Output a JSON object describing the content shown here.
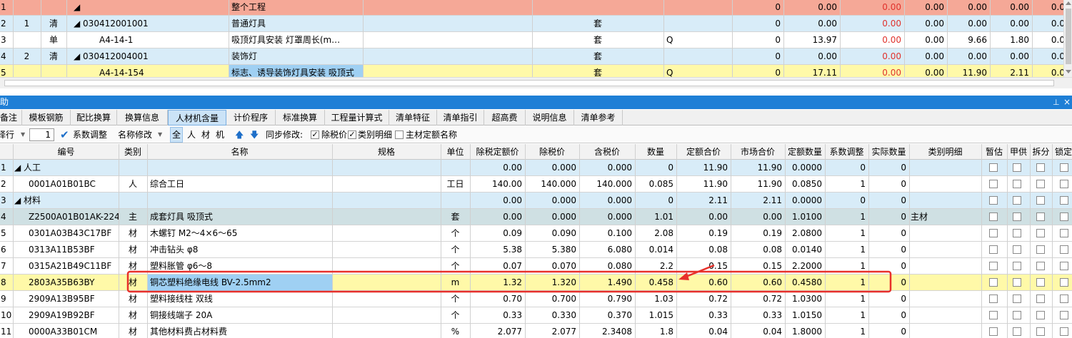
{
  "top_rows": [
    {
      "idx": "1",
      "seq": "",
      "type": "",
      "code": "◢",
      "name": "整个工程",
      "unit": "",
      "q": "",
      "v1": "0",
      "v2": "0.00",
      "v3": "0.00",
      "v4": "0.00",
      "v5": "0.00",
      "v6": "0.00",
      "v7": "0.0"
    },
    {
      "idx": "2",
      "seq": "1",
      "type": "清",
      "code": "◢ 030412001001",
      "name": "普通灯具",
      "unit": "套",
      "q": "",
      "v1": "0",
      "v2": "0.00",
      "v3": "0.00",
      "v4": "0.00",
      "v5": "0.00",
      "v6": "0.00",
      "v7": "0.0"
    },
    {
      "idx": "3",
      "seq": "",
      "type": "单",
      "code": "A4-14-1",
      "name": "吸顶灯具安装 灯罩周长(m…",
      "unit": "套",
      "q": "Q",
      "v1": "0",
      "v2": "13.97",
      "v3": "0.00",
      "v4": "0.00",
      "v5": "9.66",
      "v6": "1.80",
      "v7": "0.0"
    },
    {
      "idx": "4",
      "seq": "2",
      "type": "清",
      "code": "◢ 030412004001",
      "name": "装饰灯",
      "unit": "套",
      "q": "",
      "v1": "0",
      "v2": "0.00",
      "v3": "0.00",
      "v4": "0.00",
      "v5": "0.00",
      "v6": "0.00",
      "v7": "0.0"
    },
    {
      "idx": "5",
      "seq": "",
      "type": "",
      "code": "A4-14-154",
      "name": "标志、诱导装饰灯具安装 吸顶式",
      "unit": "套",
      "q": "Q",
      "v1": "0",
      "v2": "17.11",
      "v3": "0.00",
      "v4": "0.00",
      "v5": "11.90",
      "v6": "2.11",
      "v7": "0.0"
    }
  ],
  "panel_title": "辅助",
  "tabs": [
    "备注",
    "模板钢筋",
    "配比换算",
    "换算信息",
    "人材机含量",
    "计价程序",
    "标准换算",
    "工程量计算式",
    "清单特征",
    "清单指引",
    "超高费",
    "说明信息",
    "清单参考"
  ],
  "active_tab": 4,
  "toolbar": {
    "row_label": "择行",
    "row_value": "1",
    "coef_adjust": "系数调整",
    "name_modify": "名称修改",
    "filters": [
      "全",
      "人",
      "材",
      "机"
    ],
    "sync_label": "同步修改:",
    "chk_tax": "除税价",
    "chk_category": "类别明细",
    "chk_main": "主材定额名称"
  },
  "columns": [
    "编号",
    "类别",
    "名称",
    "规格",
    "单位",
    "除税定额价",
    "除税价",
    "含税价",
    "数量",
    "定额合价",
    "市场合价",
    "定额数量",
    "系数调整",
    "实际数量",
    "类别明细",
    "暂估",
    "甲供",
    "拆分",
    "锁定"
  ],
  "rows": [
    {
      "idx": "1",
      "code": "◢ 人工",
      "cat": "",
      "name": "",
      "unit": "",
      "p1": "0.00",
      "p2": "0.000",
      "p3": "0.000",
      "qty": "0",
      "a1": "11.90",
      "a2": "11.90",
      "dq": "0.0000",
      "coef": "0",
      "act": "0",
      "detail": "",
      "group": true
    },
    {
      "idx": "2",
      "code": "0001A01B01BC",
      "cat": "人",
      "name": "综合工日",
      "unit": "工日",
      "p1": "140.00",
      "p2": "140.000",
      "p3": "140.000",
      "qty": "0.085",
      "a1": "11.90",
      "a2": "11.90",
      "dq": "0.0850",
      "coef": "1",
      "act": "0",
      "detail": ""
    },
    {
      "idx": "3",
      "code": "◢ 材料",
      "cat": "",
      "name": "",
      "unit": "",
      "p1": "0.00",
      "p2": "0.000",
      "p3": "0.000",
      "qty": "0",
      "a1": "2.11",
      "a2": "2.11",
      "dq": "0.0000",
      "coef": "0",
      "act": "0",
      "detail": "",
      "group": true
    },
    {
      "idx": "4",
      "code": "Z2500A01B01AK-224",
      "cat": "主",
      "name": "成套灯具 吸顶式",
      "unit": "套",
      "p1": "0.00",
      "p2": "0.000",
      "p3": "0.000",
      "qty": "1.01",
      "a1": "0.00",
      "a2": "0.00",
      "dq": "1.0100",
      "coef": "1",
      "act": "0",
      "detail": "主材",
      "main": true
    },
    {
      "idx": "5",
      "code": "0301A03B43C17BF",
      "cat": "材",
      "name": "木螺钉 M2～4×6～65",
      "unit": "个",
      "p1": "0.09",
      "p2": "0.090",
      "p3": "0.100",
      "qty": "2.08",
      "a1": "0.19",
      "a2": "0.19",
      "dq": "2.0800",
      "coef": "1",
      "act": "0",
      "detail": ""
    },
    {
      "idx": "6",
      "code": "0313A11B53BF",
      "cat": "材",
      "name": "冲击钻头 φ8",
      "unit": "个",
      "p1": "5.38",
      "p2": "5.380",
      "p3": "6.080",
      "qty": "0.014",
      "a1": "0.08",
      "a2": "0.08",
      "dq": "0.0140",
      "coef": "1",
      "act": "0",
      "detail": ""
    },
    {
      "idx": "7",
      "code": "0315A21B49C11BF",
      "cat": "材",
      "name": "塑料胀管 φ6～8",
      "unit": "个",
      "p1": "0.07",
      "p2": "0.070",
      "p3": "0.080",
      "qty": "2.2",
      "a1": "0.15",
      "a2": "0.15",
      "dq": "2.2000",
      "coef": "1",
      "act": "0",
      "detail": ""
    },
    {
      "idx": "8",
      "code": "2803A35B63BY",
      "cat": "材",
      "name": "铜芯塑料绝缘电线 BV-2.5mm2",
      "unit": "m",
      "p1": "1.32",
      "p2": "1.320",
      "p3": "1.490",
      "qty": "0.458",
      "a1": "0.60",
      "a2": "0.60",
      "dq": "0.4580",
      "coef": "1",
      "act": "0",
      "detail": "",
      "sel": true
    },
    {
      "idx": "9",
      "code": "2909A13B95BF",
      "cat": "材",
      "name": "塑料接线柱 双线",
      "unit": "个",
      "p1": "0.70",
      "p2": "0.700",
      "p3": "0.790",
      "qty": "1.03",
      "a1": "0.72",
      "a2": "0.72",
      "dq": "1.0300",
      "coef": "1",
      "act": "0",
      "detail": ""
    },
    {
      "idx": "10",
      "code": "2909A19B92BF",
      "cat": "材",
      "name": "铜接线端子 20A",
      "unit": "个",
      "p1": "0.33",
      "p2": "0.330",
      "p3": "0.370",
      "qty": "1.015",
      "a1": "0.33",
      "a2": "0.33",
      "dq": "1.0150",
      "coef": "1",
      "act": "0",
      "detail": ""
    },
    {
      "idx": "11",
      "code": "0000A33B01CM",
      "cat": "材",
      "name": "其他材料费占材料费",
      "unit": "%",
      "p1": "2.077",
      "p2": "2.077",
      "p3": "2.3408",
      "qty": "1.8",
      "a1": "0.04",
      "a2": "0.04",
      "dq": "1.8000",
      "coef": "1",
      "act": "0",
      "detail": ""
    }
  ],
  "colors": {
    "accent": "#1e7fd6",
    "header_bg": "#f2f2f2",
    "row_alt": "#d8ecf8",
    "row_selected": "#fff9a8",
    "top_first": "#f5a897",
    "annot_red": "#e8302a"
  }
}
